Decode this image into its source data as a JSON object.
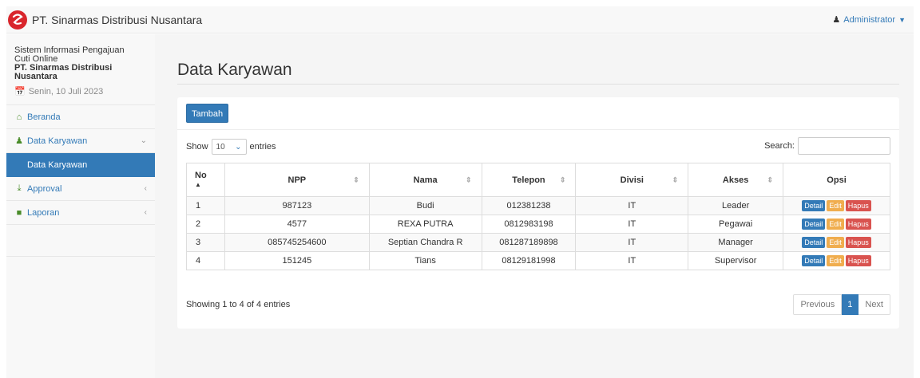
{
  "navbar": {
    "brand": "PT. Sinarmas Distribusi Nusantara",
    "user": "Administrator",
    "user_icon": "user-icon",
    "caret_icon": "caret-down-icon"
  },
  "sidebar": {
    "title_line1": "Sistem Informasi Pengajuan",
    "title_line2": "Cuti Online",
    "company_line1": "PT. Sinarmas Distribusi",
    "company_line2": "Nusantara",
    "date": "Senin, 10 Juli 2023",
    "items": [
      {
        "label": "Beranda",
        "icon": "home-icon"
      },
      {
        "label": "Data Karyawan",
        "icon": "users-icon",
        "sub": "Data Karyawan"
      },
      {
        "label": "Approval",
        "icon": "approval-icon"
      },
      {
        "label": "Laporan",
        "icon": "folder-icon"
      }
    ]
  },
  "main": {
    "title": "Data Karyawan",
    "add_button": "Tambah",
    "show_label": "Show",
    "entries_value": "10",
    "entries_label": "entries",
    "search_label": "Search:",
    "columns": [
      "No",
      "NPP",
      "Nama",
      "Telepon",
      "Divisi",
      "Akses",
      "Opsi"
    ],
    "rows": [
      {
        "no": "1",
        "npp": "987123",
        "nama": "Budi",
        "telepon": "012381238",
        "divisi": "IT",
        "akses": "Leader"
      },
      {
        "no": "2",
        "npp": "4577",
        "nama": "REXA PUTRA",
        "telepon": "0812983198",
        "divisi": "IT",
        "akses": "Pegawai"
      },
      {
        "no": "3",
        "npp": "085745254600",
        "nama": "Septian Chandra R",
        "telepon": "081287189898",
        "divisi": "IT",
        "akses": "Manager"
      },
      {
        "no": "4",
        "npp": "151245",
        "nama": "Tians",
        "telepon": "08129181998",
        "divisi": "IT",
        "akses": "Supervisor"
      }
    ],
    "action_labels": {
      "detail": "Detail",
      "edit": "Edit",
      "hapus": "Hapus"
    },
    "info": "Showing 1 to 4 of 4 entries",
    "pager": {
      "previous": "Previous",
      "current": "1",
      "next": "Next"
    }
  },
  "colors": {
    "primary": "#337ab7",
    "warning": "#f0ad4e",
    "danger": "#d9534f",
    "logo": "#d9262c"
  }
}
